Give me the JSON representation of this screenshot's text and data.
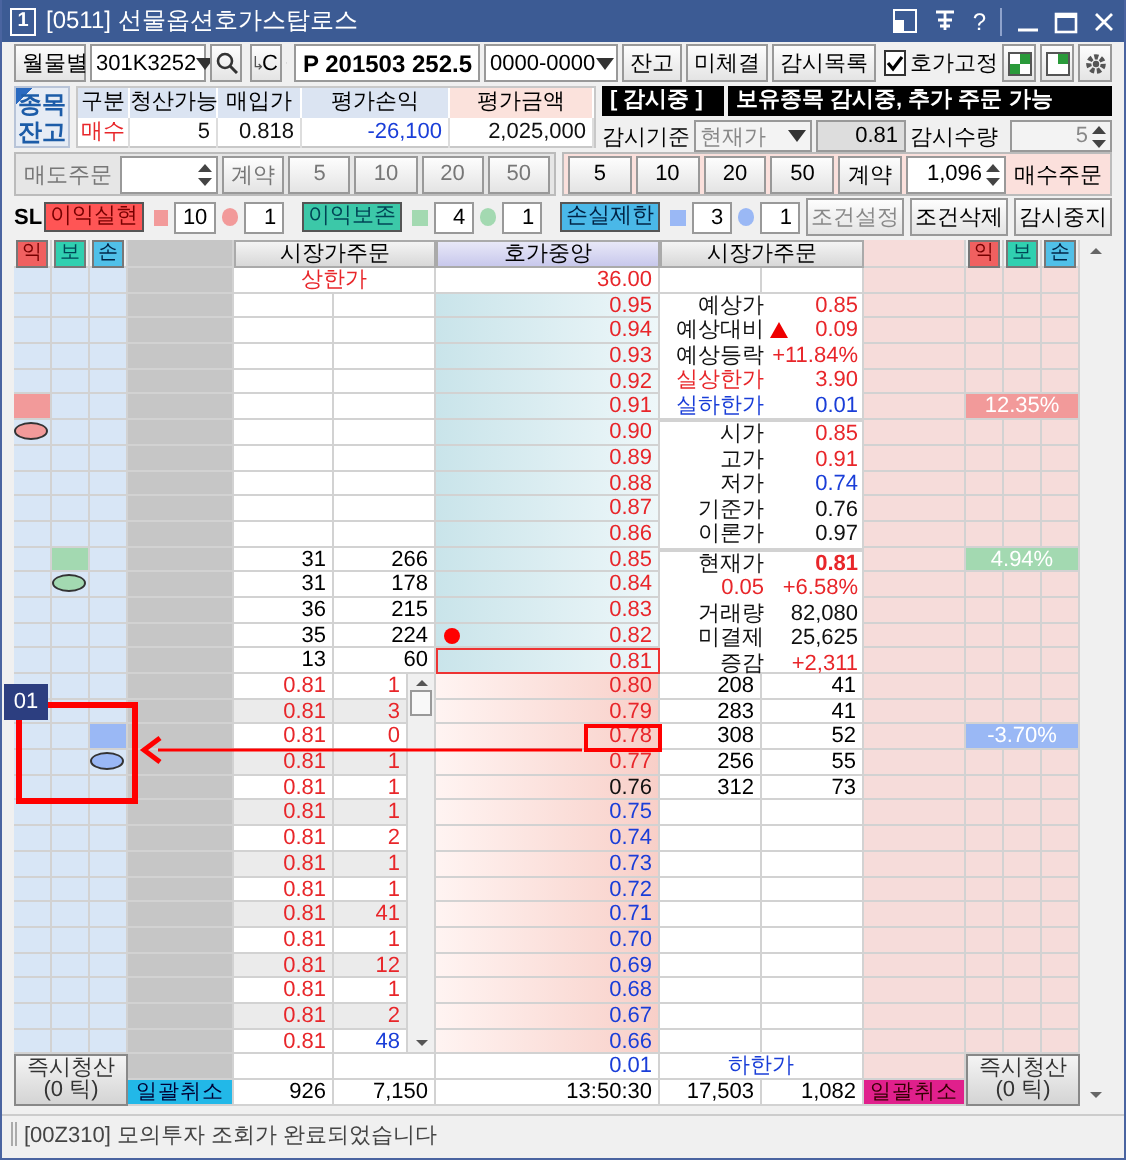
{
  "window": {
    "badge": "1",
    "title": "[0511] 선물옵션호가스탑로스",
    "help": "?"
  },
  "toolbar": {
    "mode_button": "월물별",
    "code": "301K3252",
    "code_button": "C",
    "symbol": "P 201503 252.5",
    "account": "0000-0000",
    "buttons": [
      "잔고",
      "미체결",
      "감시목록"
    ],
    "fix": {
      "label": "호가고정",
      "checked": true
    }
  },
  "balance": {
    "tab": [
      "종목",
      "잔고"
    ],
    "columns": [
      "구분",
      "청산가능",
      "매입가",
      "평가손익",
      "평가금액"
    ],
    "values": [
      {
        "text": "매수",
        "up": true,
        "down": false
      },
      {
        "text": "5",
        "up": false,
        "down": false
      },
      {
        "text": "0.818",
        "up": false,
        "down": false
      },
      {
        "text": "-26,100",
        "up": false,
        "down": true
      },
      {
        "text": "2,025,000",
        "up": false,
        "down": false
      }
    ]
  },
  "watch": {
    "status": "[ 감시중 ]",
    "message": "보유종목 감시중, 추가 주문 가능",
    "basis_label": "감시기준",
    "basis": "현재가",
    "basis_price": "0.81",
    "qty_label": "감시수량",
    "qty": "5"
  },
  "sell_order": {
    "label": "매도주문",
    "unit": "계약",
    "quantities": [
      "5",
      "10",
      "20",
      "50"
    ],
    "disabled": true
  },
  "buy_order": {
    "quantities": [
      "5",
      "10",
      "20",
      "50"
    ],
    "unit": "계약",
    "qty": "1,096",
    "label": "매수주문",
    "disabled": false
  },
  "stop_loss": {
    "label": "SL",
    "rules": [
      {
        "kind": "profit",
        "name": "이익실현",
        "color": "#f29a9a",
        "ticks": "10",
        "count": "1"
      },
      {
        "kind": "preserve",
        "name": "이익보존",
        "color": "#a3d9b1",
        "ticks": "4",
        "count": "1"
      },
      {
        "kind": "loss",
        "name": "손실제한",
        "color": "#9ab8f5",
        "ticks": "3",
        "count": "1"
      }
    ],
    "buttons": [
      {
        "label": "조건설정",
        "disabled": true
      },
      {
        "label": "조건삭제",
        "disabled": false
      },
      {
        "label": "감시중지",
        "disabled": false
      }
    ]
  },
  "book": {
    "marks": [
      "익",
      "보",
      "손"
    ],
    "left_header": "시장가주문",
    "center_header": "호가중앙",
    "right_header": "시장가주문",
    "marks_right": [
      "익",
      "보",
      "손"
    ],
    "upper_limit": {
      "label": "상한가",
      "price": "36.00"
    },
    "rows": [
      {
        "kind": "ask",
        "price": "0.95",
        "up": true,
        "down": false,
        "current": false,
        "dot": false
      },
      {
        "kind": "ask",
        "price": "0.94",
        "up": true,
        "down": false,
        "current": false,
        "dot": false
      },
      {
        "kind": "ask",
        "price": "0.93",
        "up": true,
        "down": false,
        "current": false,
        "dot": false
      },
      {
        "kind": "ask",
        "price": "0.92",
        "up": true,
        "down": false,
        "current": false,
        "dot": false
      },
      {
        "kind": "ask",
        "price": "0.91",
        "up": true,
        "down": false,
        "current": false,
        "dot": false,
        "stop": {
          "color": "#f29a9a",
          "pct": "12.35%"
        }
      },
      {
        "kind": "ask",
        "price": "0.90",
        "up": true,
        "down": false,
        "current": false,
        "dot": false,
        "order_marker": {
          "color": "#f29a9a"
        }
      },
      {
        "kind": "ask",
        "price": "0.89",
        "up": true,
        "down": false,
        "current": false,
        "dot": false
      },
      {
        "kind": "ask",
        "price": "0.88",
        "up": true,
        "down": false,
        "current": false,
        "dot": false
      },
      {
        "kind": "ask",
        "price": "0.87",
        "up": true,
        "down": false,
        "current": false,
        "dot": false
      },
      {
        "kind": "ask",
        "price": "0.86",
        "up": true,
        "down": false,
        "current": false,
        "dot": false
      },
      {
        "kind": "ask",
        "price": "0.85",
        "up": true,
        "down": false,
        "current": false,
        "dot": false,
        "left_1": "31",
        "left_2": "266",
        "stop": {
          "color": "#a3d9b1",
          "pct": "4.94%"
        }
      },
      {
        "kind": "ask",
        "price": "0.84",
        "up": true,
        "down": false,
        "current": false,
        "dot": false,
        "left_1": "31",
        "left_2": "178",
        "order_marker": {
          "color": "#a3d9b1"
        }
      },
      {
        "kind": "ask",
        "price": "0.83",
        "up": true,
        "down": false,
        "current": false,
        "dot": false,
        "left_1": "36",
        "left_2": "215"
      },
      {
        "kind": "ask",
        "price": "0.82",
        "up": true,
        "down": false,
        "current": false,
        "dot": true,
        "left_1": "35",
        "left_2": "224"
      },
      {
        "kind": "ask",
        "price": "0.81",
        "up": true,
        "down": false,
        "current": true,
        "dot": false,
        "left_1": "13",
        "left_2": "60"
      },
      {
        "kind": "bid",
        "price": "0.80",
        "up": true,
        "down": false,
        "current": false,
        "dot": false,
        "order_price": "0.81",
        "order_qty": "1",
        "qty_down": false,
        "right_1": "208",
        "right_2": "41"
      },
      {
        "kind": "bid",
        "price": "0.79",
        "up": true,
        "down": false,
        "current": false,
        "dot": false,
        "order_price": "0.81",
        "order_qty": "3",
        "qty_down": false,
        "right_1": "283",
        "right_2": "41"
      },
      {
        "kind": "bid",
        "price": "0.78",
        "up": true,
        "down": false,
        "current": false,
        "dot": false,
        "order_price": "0.81",
        "order_qty": "0",
        "qty_down": false,
        "right_1": "308",
        "right_2": "52",
        "stop": {
          "color": "#9ab8f5",
          "pct": "-3.70%"
        }
      },
      {
        "kind": "bid",
        "price": "0.77",
        "up": true,
        "down": false,
        "current": false,
        "dot": false,
        "order_price": "0.81",
        "order_qty": "1",
        "qty_down": false,
        "right_1": "256",
        "right_2": "55",
        "order_marker": {
          "color": "#9ab8f5"
        }
      },
      {
        "kind": "bid",
        "price": "0.76",
        "up": false,
        "down": false,
        "current": false,
        "dot": false,
        "order_price": "0.81",
        "order_qty": "1",
        "qty_down": false,
        "right_1": "312",
        "right_2": "73"
      },
      {
        "kind": "bid",
        "price": "0.75",
        "up": false,
        "down": true,
        "current": false,
        "dot": false,
        "order_price": "0.81",
        "order_qty": "1",
        "qty_down": false
      },
      {
        "kind": "bid",
        "price": "0.74",
        "up": false,
        "down": true,
        "current": false,
        "dot": false,
        "order_price": "0.81",
        "order_qty": "2",
        "qty_down": false
      },
      {
        "kind": "bid",
        "price": "0.73",
        "up": false,
        "down": true,
        "current": false,
        "dot": false,
        "order_price": "0.81",
        "order_qty": "1",
        "qty_down": false
      },
      {
        "kind": "bid",
        "price": "0.72",
        "up": false,
        "down": true,
        "current": false,
        "dot": false,
        "order_price": "0.81",
        "order_qty": "1",
        "qty_down": false
      },
      {
        "kind": "bid",
        "price": "0.71",
        "up": false,
        "down": true,
        "current": false,
        "dot": false,
        "order_price": "0.81",
        "order_qty": "41",
        "qty_down": false
      },
      {
        "kind": "bid",
        "price": "0.70",
        "up": false,
        "down": true,
        "current": false,
        "dot": false,
        "order_price": "0.81",
        "order_qty": "1",
        "qty_down": false
      },
      {
        "kind": "bid",
        "price": "0.69",
        "up": false,
        "down": true,
        "current": false,
        "dot": false,
        "order_price": "0.81",
        "order_qty": "12",
        "qty_down": false
      },
      {
        "kind": "bid",
        "price": "0.68",
        "up": false,
        "down": true,
        "current": false,
        "dot": false,
        "order_price": "0.81",
        "order_qty": "1",
        "qty_down": false
      },
      {
        "kind": "bid",
        "price": "0.67",
        "up": false,
        "down": true,
        "current": false,
        "dot": false,
        "order_price": "0.81",
        "order_qty": "2",
        "qty_down": false
      },
      {
        "kind": "bid",
        "price": "0.66",
        "up": false,
        "down": true,
        "current": false,
        "dot": false,
        "order_price": "0.81",
        "order_qty": "48",
        "qty_down": true
      }
    ],
    "info": [
      [
        {
          "label": "예상가",
          "value": "0.85",
          "label_up": false,
          "label_down": false,
          "value_up": true,
          "value_down": false,
          "arrow_up": false,
          "bold": false
        },
        {
          "label": "예상대비",
          "value": "0.09",
          "label_up": false,
          "label_down": false,
          "value_up": true,
          "value_down": false,
          "arrow_up": true,
          "bold": false
        },
        {
          "label": "예상등락",
          "value": "+11.84%",
          "label_up": false,
          "label_down": false,
          "value_up": true,
          "value_down": false,
          "arrow_up": false,
          "bold": false
        },
        {
          "label": "실상한가",
          "value": "3.90",
          "label_up": true,
          "label_down": false,
          "value_up": true,
          "value_down": false,
          "arrow_up": false,
          "bold": false
        },
        {
          "label": "실하한가",
          "value": "0.01",
          "label_up": false,
          "label_down": true,
          "value_up": false,
          "value_down": true,
          "arrow_up": false,
          "bold": false
        }
      ],
      [
        {
          "label": "시가",
          "value": "0.85",
          "label_up": false,
          "label_down": false,
          "value_up": true,
          "value_down": false,
          "arrow_up": false,
          "bold": false
        },
        {
          "label": "고가",
          "value": "0.91",
          "label_up": false,
          "label_down": false,
          "value_up": true,
          "value_down": false,
          "arrow_up": false,
          "bold": false
        },
        {
          "label": "저가",
          "value": "0.74",
          "label_up": false,
          "label_down": false,
          "value_up": false,
          "value_down": true,
          "arrow_up": false,
          "bold": false
        },
        {
          "label": "기준가",
          "value": "0.76",
          "label_up": false,
          "label_down": false,
          "value_up": false,
          "value_down": false,
          "arrow_up": false,
          "bold": false
        },
        {
          "label": "이론가",
          "value": "0.97",
          "label_up": false,
          "label_down": false,
          "value_up": false,
          "value_down": false,
          "arrow_up": false,
          "bold": false
        }
      ],
      [
        {
          "label": "현재가",
          "value": "0.81",
          "label_up": false,
          "label_down": false,
          "value_up": true,
          "value_down": false,
          "arrow_up": false,
          "bold": true
        },
        {
          "label": "0.05",
          "value": "+6.58%",
          "label_up": true,
          "label_down": false,
          "value_up": true,
          "value_down": false,
          "arrow_up": false,
          "bold": false
        },
        {
          "label": "거래량",
          "value": "82,080",
          "label_up": false,
          "label_down": false,
          "value_up": false,
          "value_down": false,
          "arrow_up": false,
          "bold": false
        },
        {
          "label": "미결제",
          "value": "25,625",
          "label_up": false,
          "label_down": false,
          "value_up": false,
          "value_down": false,
          "arrow_up": false,
          "bold": false
        },
        {
          "label": "증감",
          "value": "+2,311",
          "label_up": false,
          "label_down": false,
          "value_up": true,
          "value_down": false,
          "arrow_up": false,
          "bold": false
        }
      ]
    ],
    "lower_limit": {
      "price": "0.01",
      "label": "하한가"
    },
    "totals": {
      "cancel_left": "일괄취소",
      "left_1": "926",
      "left_2": "7,150",
      "time": "13:50:30",
      "right_1": "17,503",
      "right_2": "1,082",
      "cancel_right": "일괄취소"
    },
    "liquidate_left": {
      "label": "즉시청산",
      "sub": "(0 틱)"
    },
    "liquidate_right": {
      "label": "즉시청산",
      "sub": "(0 틱)"
    }
  },
  "annotation": {
    "label": "01"
  },
  "status_bar": "[00Z310] 모의투자 조회가 완료되었습니다"
}
